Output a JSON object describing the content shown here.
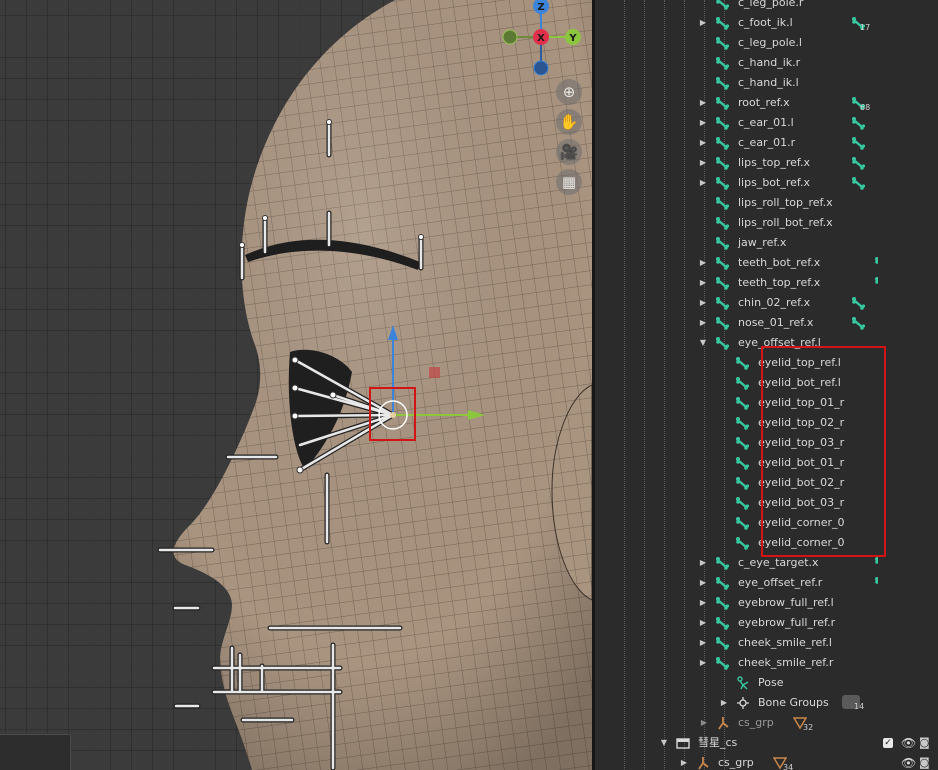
{
  "viewport": {
    "gizmo": {
      "z": "Z",
      "x": "X",
      "y": "Y"
    },
    "nav_buttons": [
      {
        "name": "zoom-icon",
        "glyph": "⊕"
      },
      {
        "name": "pan-hand-icon",
        "glyph": "✋"
      },
      {
        "name": "camera-view-icon",
        "glyph": "🎥"
      },
      {
        "name": "ortho-grid-icon",
        "glyph": "▦"
      }
    ]
  },
  "outliner": {
    "rows": [
      {
        "label": "c_leg_pole.r",
        "indent": 1,
        "arrow": "",
        "badge": "",
        "tail": ""
      },
      {
        "label": "c_foot_ik.l",
        "indent": 1,
        "arrow": "▶",
        "badge": "17",
        "tail": "bone"
      },
      {
        "label": "c_leg_pole.l",
        "indent": 1,
        "arrow": "",
        "badge": "",
        "tail": ""
      },
      {
        "label": "c_hand_ik.r",
        "indent": 1,
        "arrow": "",
        "badge": "",
        "tail": ""
      },
      {
        "label": "c_hand_ik.l",
        "indent": 1,
        "arrow": "",
        "badge": "",
        "tail": ""
      },
      {
        "label": "root_ref.x",
        "indent": 1,
        "arrow": "▶",
        "badge": "68",
        "tail": "bone"
      },
      {
        "label": "c_ear_01.l",
        "indent": 1,
        "arrow": "▶",
        "badge": "",
        "tail": "bone"
      },
      {
        "label": "c_ear_01.r",
        "indent": 1,
        "arrow": "▶",
        "badge": "",
        "tail": "bone"
      },
      {
        "label": "lips_top_ref.x",
        "indent": 1,
        "arrow": "▶",
        "badge": "",
        "tail": "bone"
      },
      {
        "label": "lips_bot_ref.x",
        "indent": 1,
        "arrow": "▶",
        "badge": "",
        "tail": "bone"
      },
      {
        "label": "lips_roll_top_ref.x",
        "indent": 1,
        "arrow": "",
        "badge": "",
        "tail": ""
      },
      {
        "label": "lips_roll_bot_ref.x",
        "indent": 1,
        "arrow": "",
        "badge": "",
        "tail": ""
      },
      {
        "label": "jaw_ref.x",
        "indent": 1,
        "arrow": "",
        "badge": "",
        "tail": ""
      },
      {
        "label": "teeth_bot_ref.x",
        "indent": 1,
        "arrow": "▶",
        "badge": "",
        "tail": "bone-clip"
      },
      {
        "label": "teeth_top_ref.x",
        "indent": 1,
        "arrow": "▶",
        "badge": "",
        "tail": "bone-clip"
      },
      {
        "label": "chin_02_ref.x",
        "indent": 1,
        "arrow": "▶",
        "badge": "",
        "tail": "bone"
      },
      {
        "label": "nose_01_ref.x",
        "indent": 1,
        "arrow": "▶",
        "badge": "",
        "tail": "bone"
      },
      {
        "label": "eye_offset_ref.l",
        "indent": 1,
        "arrow": "▼",
        "badge": "",
        "tail": ""
      },
      {
        "label": "eyelid_top_ref.l",
        "indent": 2,
        "arrow": "",
        "badge": "",
        "tail": ""
      },
      {
        "label": "eyelid_bot_ref.l",
        "indent": 2,
        "arrow": "",
        "badge": "",
        "tail": ""
      },
      {
        "label": "eyelid_top_01_r",
        "indent": 2,
        "arrow": "",
        "badge": "",
        "tail": ""
      },
      {
        "label": "eyelid_top_02_r",
        "indent": 2,
        "arrow": "",
        "badge": "",
        "tail": ""
      },
      {
        "label": "eyelid_top_03_r",
        "indent": 2,
        "arrow": "",
        "badge": "",
        "tail": ""
      },
      {
        "label": "eyelid_bot_01_r",
        "indent": 2,
        "arrow": "",
        "badge": "",
        "tail": ""
      },
      {
        "label": "eyelid_bot_02_r",
        "indent": 2,
        "arrow": "",
        "badge": "",
        "tail": ""
      },
      {
        "label": "eyelid_bot_03_r",
        "indent": 2,
        "arrow": "",
        "badge": "",
        "tail": ""
      },
      {
        "label": "eyelid_corner_0",
        "indent": 2,
        "arrow": "",
        "badge": "",
        "tail": ""
      },
      {
        "label": "eyelid_corner_0",
        "indent": 2,
        "arrow": "",
        "badge": "",
        "tail": ""
      },
      {
        "label": "c_eye_target.x",
        "indent": 1,
        "arrow": "▶",
        "badge": "",
        "tail": "bone-clip"
      },
      {
        "label": "eye_offset_ref.r",
        "indent": 1,
        "arrow": "▶",
        "badge": "",
        "tail": "bone-clip"
      },
      {
        "label": "eyebrow_full_ref.l",
        "indent": 1,
        "arrow": "▶",
        "badge": "",
        "tail": ""
      },
      {
        "label": "eyebrow_full_ref.r",
        "indent": 1,
        "arrow": "▶",
        "badge": "",
        "tail": ""
      },
      {
        "label": "cheek_smile_ref.l",
        "indent": 1,
        "arrow": "▶",
        "badge": "",
        "tail": ""
      },
      {
        "label": "cheek_smile_ref.r",
        "indent": 1,
        "arrow": "▶",
        "badge": "",
        "tail": ""
      }
    ],
    "pose": {
      "label": "Pose"
    },
    "bone_groups": {
      "label": "Bone Groups",
      "badge": "14"
    },
    "cs_grp_1": {
      "label": "cs_grp",
      "badge": "32"
    },
    "collection": {
      "label": "彗星_cs"
    },
    "cs_grp_2": {
      "label": "cs_grp",
      "badge": "34"
    }
  },
  "colors": {
    "selection_box": "#d21414",
    "bone_icon": "#37c8a0",
    "skin": "#a99480",
    "axis_x": "#e0304a",
    "axis_y": "#8cc63e",
    "axis_z": "#3b84d9"
  }
}
